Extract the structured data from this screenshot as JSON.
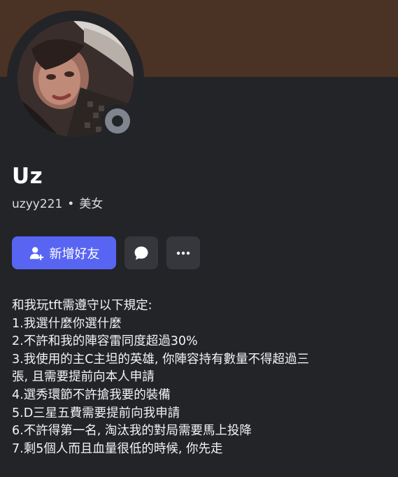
{
  "profile": {
    "display_name": "Uz",
    "username": "uzyy221",
    "separator": "•",
    "pronouns": "美女"
  },
  "actions": {
    "add_friend_label": "新增好友",
    "message_icon": "chat-bubble-icon",
    "more_icon": "ellipsis-icon"
  },
  "bio": {
    "lines": [
      "和我玩tft需遵守以下規定:",
      "1.我選什麼你選什麼",
      "2.不許和我的陣容雷同度超過30%",
      "3.我使用的主C主坦的英雄, 你陣容持有數量不得超過三",
      "張, 且需要提前向本人申請",
      "4.選秀環節不許搶我要的裝備",
      "5.D三星五費需要提前向我申請",
      "6.不許得第一名, 淘汰我的對局需要馬上投降",
      "7.剩5個人而且血量很低的時候, 你先走"
    ]
  },
  "colors": {
    "banner": "#4a3224",
    "background": "#232428",
    "accent": "#5865f2",
    "status_offline": "#80848e",
    "secondary_button": "#36373d"
  }
}
